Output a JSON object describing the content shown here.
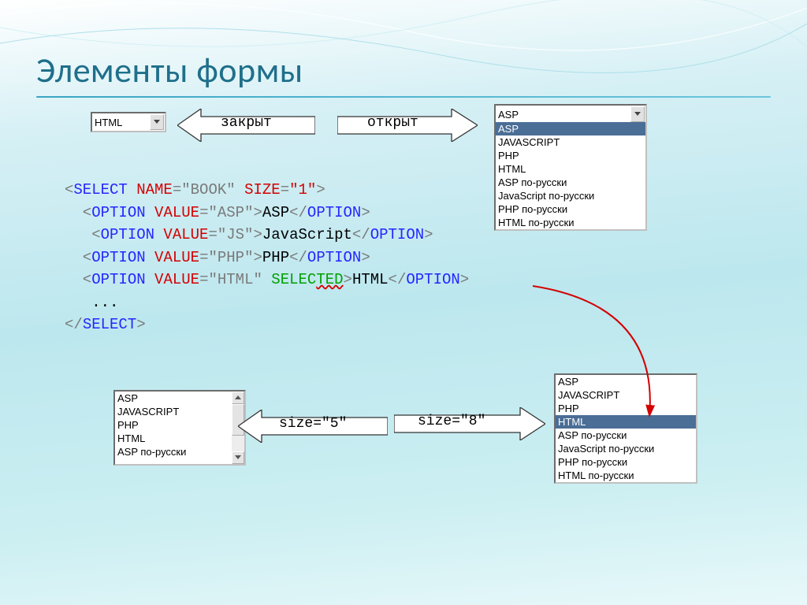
{
  "title": "Элементы формы",
  "labels": {
    "closed": "закрыт",
    "open": "открыт",
    "size5": "size=\"5\"",
    "size8": "size=\"8\""
  },
  "dropdown_closed": {
    "selected": "HTML"
  },
  "options_full": [
    "ASP",
    "JAVASCRIPT",
    "PHP",
    "HTML",
    "ASP по-русски",
    "JavaScript по-русски",
    "PHP по-русски",
    "HTML по-русски"
  ],
  "list_open_top_selected_index": 0,
  "list_size5_visible": [
    "ASP",
    "JAVASCRIPT",
    "PHP",
    "HTML",
    "ASP по-русски"
  ],
  "list_size8_selected_index": 3,
  "code": {
    "l1": {
      "a": "<",
      "b": "select",
      "c": " name",
      "d": "=\"book\"",
      "e": " size",
      "f": "=",
      "g": "\"1\"",
      "h": ">"
    },
    "l2": {
      "a": "  <",
      "b": "option",
      "c": " value",
      "d": "=\"asp\"",
      "e": ">",
      "f": "ASP",
      "g": "</",
      "h": "option",
      "i": ">"
    },
    "l3": {
      "a": "   <",
      "b": "option",
      "c": " value",
      "d": "=\"js\"",
      "e": ">",
      "f": "JavaScript",
      "g": "</",
      "h": "option",
      "i": ">"
    },
    "l4": {
      "a": "  <",
      "b": "option",
      "c": " value",
      "d": "=\"php\"",
      "e": ">",
      "f": "PHP",
      "g": "</",
      "h": "option",
      "i": ">"
    },
    "l5": {
      "a": "  <",
      "b": "option",
      "c": " value",
      "d": "=\"html\"",
      "e": " selec",
      "ex": "ted",
      "f": ">",
      "g": "HTML",
      "h": "</",
      "i": "option",
      "j": ">"
    },
    "l6": "   ...",
    "l7": {
      "a": "</",
      "b": "select",
      "c": ">"
    }
  }
}
